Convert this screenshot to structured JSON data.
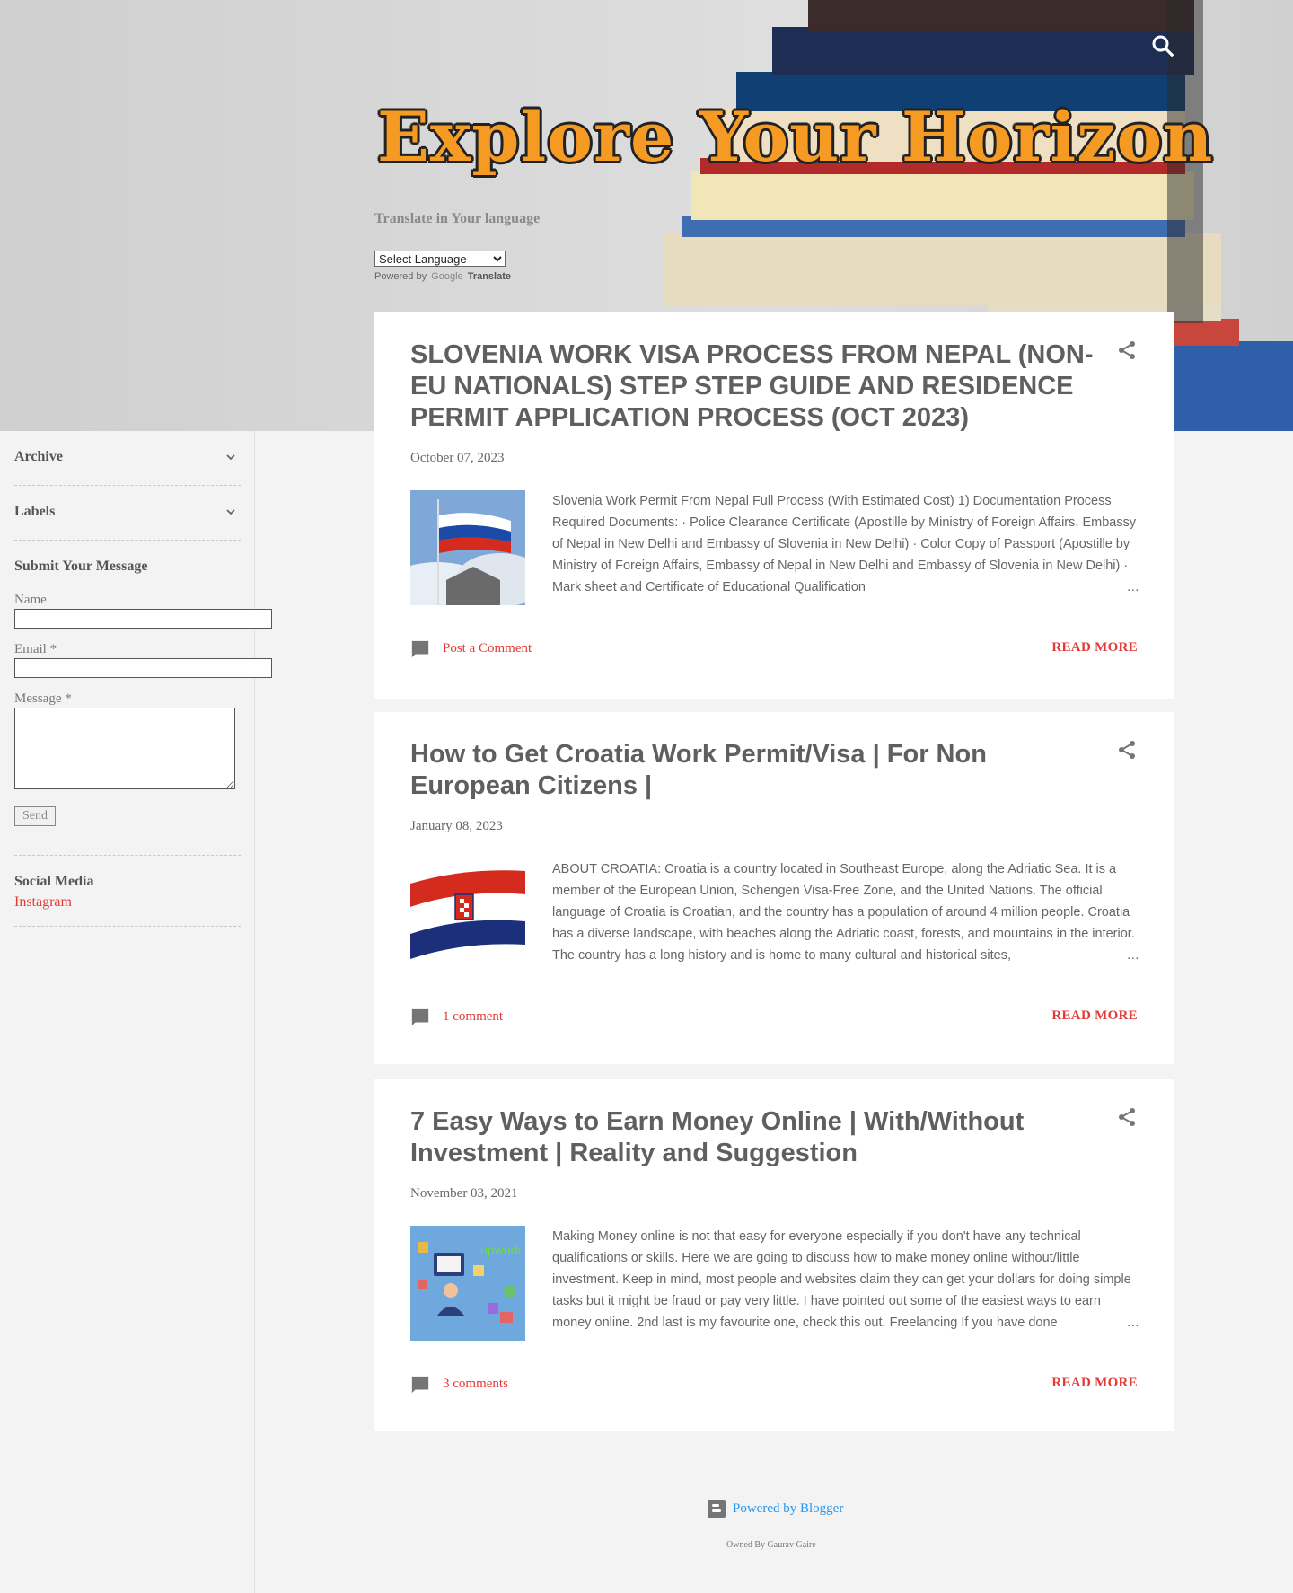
{
  "header": {
    "logo_text": "Explore Your Horizon",
    "translate_title": "Translate in Your language",
    "language_select": "Select Language",
    "powered_by": "Powered by",
    "google": "Google",
    "translate_link": "Translate"
  },
  "sidebar": {
    "archive": "Archive",
    "labels": "Labels",
    "form_title": "Submit Your Message",
    "name_label": "Name",
    "email_label": "Email *",
    "message_label": "Message *",
    "send_label": "Send",
    "social_title": "Social Media",
    "instagram": "Instagram"
  },
  "posts": [
    {
      "title": "SLOVENIA WORK VISA PROCESS FROM NEPAL (NON-EU NATIONALS) STEP STEP GUIDE AND RESIDENCE PERMIT APPLICATION PROCESS (OCT 2023)",
      "date": "October 07, 2023",
      "snippet": "   Slovenia Work Permit From Nepal Full Process (With Estimated Cost)   1) Documentation Process Required Documents: ·         Police Clearance Certificate (Apostille by Ministry of Foreign Affairs, Embassy of Nepal in New Delhi and Embassy of Slovenia in New Delhi) ·         Color Copy of Passport (Apostille by Ministry of Foreign Affairs, Embassy of Nepal in New Delhi and Embassy of Slovenia in New Delhi) ·         Mark sheet and Certificate of Educational Qualification",
      "ellipsis": "…",
      "comments": "Post a Comment",
      "read_more": "READ MORE"
    },
    {
      "title": "How to Get Croatia Work Permit/Visa | For Non European Citizens |",
      "date": "January 08, 2023",
      "snippet": "  ABOUT CROATIA: Croatia is a country located in Southeast Europe, along the Adriatic Sea. It is a member of the European Union, Schengen Visa-Free Zone, and the United Nations. The official language of Croatia is Croatian, and the country has a population of around 4 million people. Croatia has a diverse landscape, with beaches along the Adriatic coast, forests, and mountains in the interior. The country has a long history and is home to many cultural and historical sites,",
      "ellipsis": "…",
      "comments": "1 comment",
      "read_more": "READ MORE"
    },
    {
      "title": "7 Easy Ways to Earn Money Online | With/Without Investment | Reality and Suggestion",
      "date": "November 03, 2021",
      "snippet": "  Making Money online is not that easy for everyone especially if you don't have any technical qualifications or skills. Here we are going to discuss how to make money online without/little investment. Keep in mind, most people and websites claim they can get your dollars for doing simple tasks but it might be fraud or pay very little. I have pointed out some of the easiest ways to earn money online. 2nd last is my favourite one, check this out. Freelancing If you have done",
      "ellipsis": "…",
      "comments": "3 comments",
      "read_more": "READ MORE"
    }
  ],
  "thumb3_text": "upwork",
  "footer": {
    "powered_by_blogger": "Powered by Blogger",
    "owner": "Owned By Gaurav Gaire"
  },
  "colors": {
    "accent_red": "#e53935",
    "logo_orange": "#f59a23",
    "blogger_blue": "#2196f3"
  },
  "icons": [
    "search-icon",
    "chevron-down-icon",
    "share-icon",
    "comment-icon",
    "blogger-icon"
  ]
}
